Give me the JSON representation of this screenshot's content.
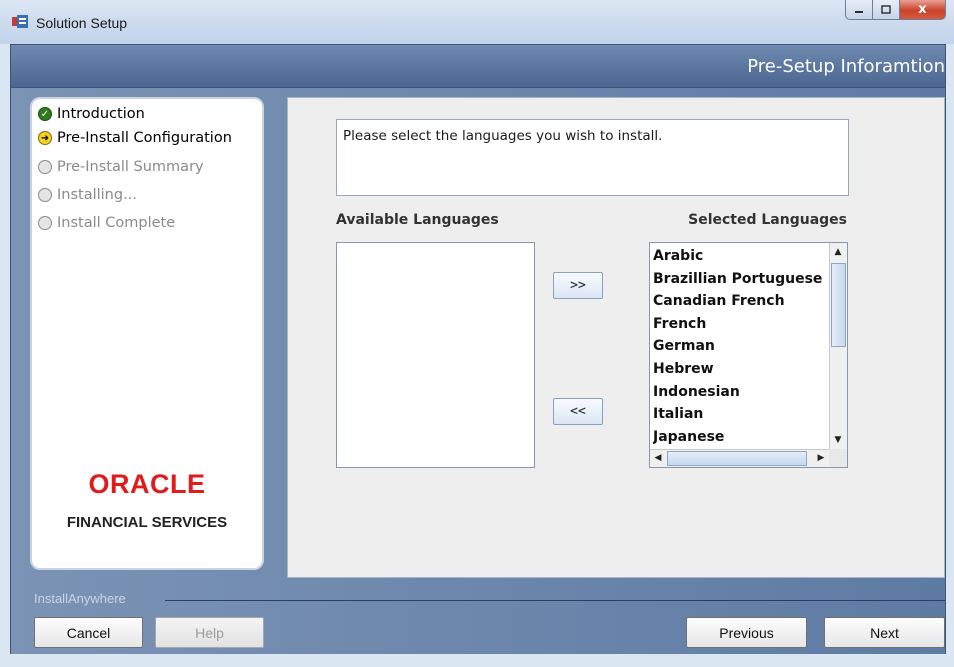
{
  "window": {
    "title": "Solution Setup",
    "close_glyph": "x"
  },
  "header": {
    "title": "Pre-Setup Inforamtion"
  },
  "steps": [
    {
      "label": "Introduction",
      "state": "done"
    },
    {
      "label": "Pre-Install Configuration",
      "state": "current"
    },
    {
      "label": "Pre-Install Summary",
      "state": "pending"
    },
    {
      "label": "Installing...",
      "state": "pending"
    },
    {
      "label": "Install Complete",
      "state": "pending"
    }
  ],
  "branding": {
    "logo": "ORACLE",
    "subtitle": "FINANCIAL SERVICES"
  },
  "main": {
    "instruction": "Please select the languages you wish to install.",
    "available_heading": "Available Languages",
    "selected_heading": "Selected Languages",
    "add_button": ">>",
    "remove_button": "<<",
    "available_languages": [],
    "selected_languages": [
      "Arabic",
      "Brazillian Portuguese",
      "Canadian French",
      "French",
      "German",
      "Hebrew",
      "Indonesian",
      "Italian",
      "Japanese"
    ]
  },
  "footer": {
    "label": "InstallAnywhere",
    "cancel": "Cancel",
    "help": "Help",
    "previous": "Previous",
    "next": "Next"
  },
  "colors": {
    "header_band": "#5b77a0",
    "oracle_red": "#e01b1b",
    "step_done": "#2f7a1d",
    "step_current": "#f5d21b"
  }
}
